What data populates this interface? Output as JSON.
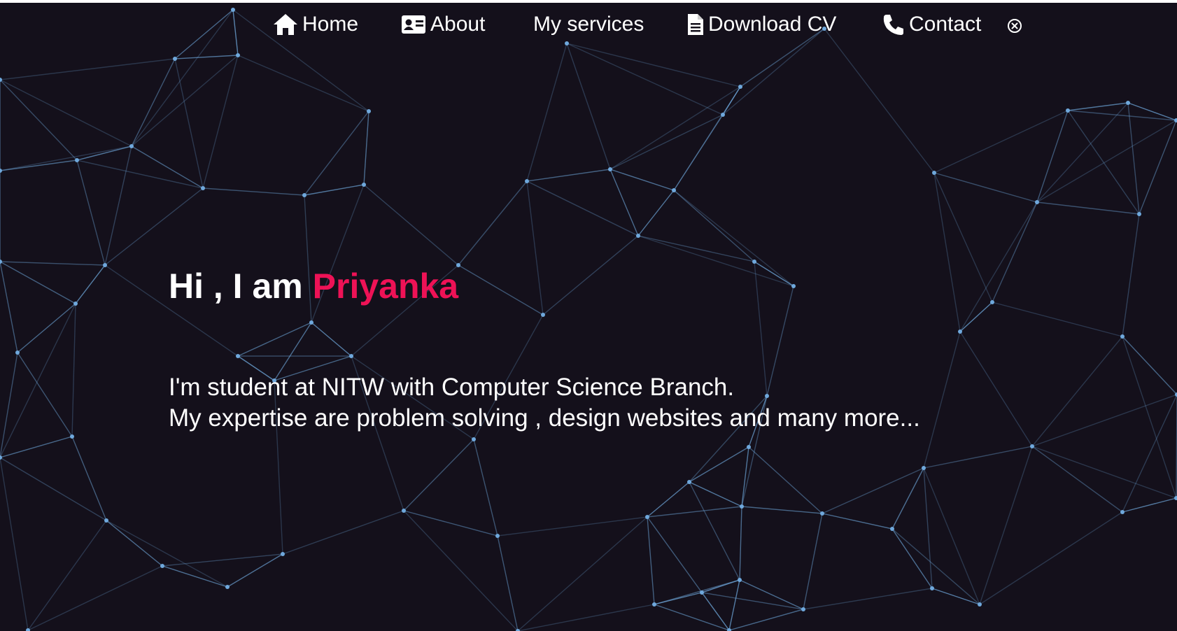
{
  "colors": {
    "background": "#14101b",
    "text": "#ffffff",
    "accent": "#ee1256",
    "network_line": "#6fa8dc"
  },
  "navbar": {
    "items": [
      {
        "label": "Home",
        "icon": "home-icon"
      },
      {
        "label": "About",
        "icon": "id-card-icon"
      },
      {
        "label": "My services",
        "icon": ""
      },
      {
        "label": "Download CV",
        "icon": "document-icon"
      },
      {
        "label": "Contact",
        "icon": "phone-icon"
      }
    ],
    "close_icon": "close-circle-icon"
  },
  "hero": {
    "greeting": "Hi , I am",
    "name": "Priyanka",
    "line1": "I'm student at NITW with Computer Science Branch.",
    "line2": "My expertise are problem solving , design websites and many more..."
  }
}
